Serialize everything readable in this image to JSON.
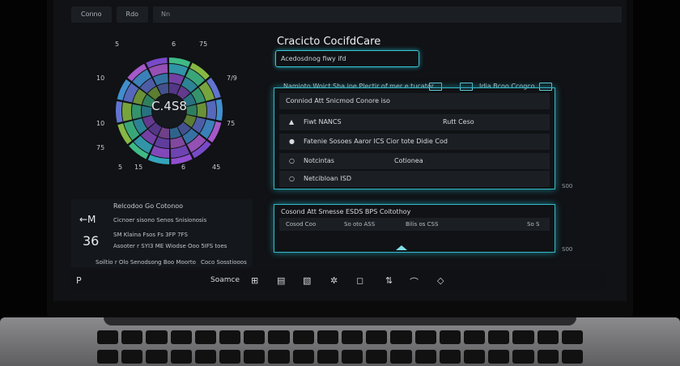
{
  "topbar": {
    "tab1": "Conno",
    "tab2": "Rdo",
    "search": "Nn"
  },
  "ring": {
    "center": "C.4S8",
    "ticks": [
      "5",
      "6",
      "75",
      "10",
      "7/9",
      "10",
      "75",
      "75",
      "5",
      "15",
      "6",
      "45"
    ],
    "colors": [
      "#8c55e6",
      "#a85bf0",
      "#3cc0d8",
      "#48d89a",
      "#9bd64b",
      "#6e86f2",
      "#4aa6ef",
      "#c066e8"
    ]
  },
  "main": {
    "title": "Cracicto CocifdCare",
    "titlebox": "Acedosdnog fiwy ifd",
    "header_left": "Namioto Woict Sha ine Plectir of mer e tucator",
    "header_right": "Idia Bcoo Ccogco",
    "rows": [
      {
        "title": "Conniod Att Snicmod Conore iso",
        "value": ""
      },
      {
        "title": "Fiwt NANCS",
        "value": "Rutt Ceso"
      },
      {
        "title": "Fatenie Sosoes Aaror ICS Cior tote Didie Cod",
        "value": ""
      },
      {
        "title": "Notcintas",
        "value": "Cotionea"
      },
      {
        "title": "Netcibloan ISD",
        "value": ""
      }
    ],
    "side_value": "S00"
  },
  "panel2": {
    "title": "Cosond Att Smesse ESDS BPS Coitothoy",
    "cols": [
      "Cosod Coo",
      "So oto ASS",
      "Bilis os CSS",
      "So S"
    ],
    "side_value": "S00"
  },
  "left2": {
    "title": "Relcodoo Go Cotonoo",
    "big1": "←M",
    "big2": "36",
    "l1": "Cicnoer sisono Senos Snisionosis",
    "l2": "SM Klaina Fsos Fs 3FP 7FS",
    "l3": "Asooter r SYI3 ME Wiodse Ooo 5IFS toes",
    "l4": "Soiltio r Olo Senodsong Boo Moorto",
    "l5": "Coco Sosstiooos"
  },
  "bottom": {
    "label": "Soamce",
    "left": "P"
  },
  "colors": {
    "accent": "#38c8d8",
    "panel": "#1b1f24",
    "screen": "#101215"
  }
}
